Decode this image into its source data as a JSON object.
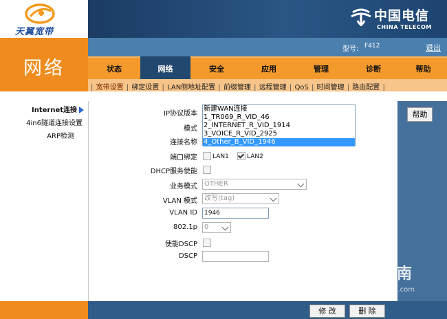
{
  "brand": {
    "left_logo_text": "天翼宽带",
    "right_logo_cn": "中国电信",
    "right_logo_en": "CHINA TELECOM"
  },
  "section_title": "网络",
  "model": {
    "label": "型号:",
    "value": "F412"
  },
  "logout_label": "退出",
  "tabs": [
    {
      "label": "状态"
    },
    {
      "label": "网络",
      "active": true
    },
    {
      "label": "安全"
    },
    {
      "label": "应用"
    },
    {
      "label": "管理"
    },
    {
      "label": "诊断"
    },
    {
      "label": "帮助"
    }
  ],
  "subnav": [
    "宽带设置",
    "绑定设置",
    "LAN侧地址配置",
    "前缀管理",
    "远程管理",
    "QoS",
    "时间管理",
    "路由配置"
  ],
  "leftnav": [
    {
      "label": "Internet连接",
      "active": true
    },
    {
      "label": "4in6隧道连接设置"
    },
    {
      "label": "ARP检测"
    }
  ],
  "help_button": "帮助",
  "form": {
    "ip_protocol_label": "IP协议版本",
    "mode_label": "模式",
    "conn_name_label": "连接名称",
    "connections": [
      "新建WAN连接",
      "1_TR069_R_VID_46",
      "2_INTERNET_R_VID_1914",
      "3_VOICE_R_VID_2925",
      "4_Other_B_VID_1946"
    ],
    "selected_connection": "4_Other_B_VID_1946",
    "port_bind_label": "端口绑定",
    "lan1_label": "LAN1",
    "lan2_label": "LAN2",
    "lan1_checked": false,
    "lan2_checked": true,
    "dhcp_label": "DHCP服务使能",
    "dhcp_checked": false,
    "service_mode_label": "业务模式",
    "service_mode_value": "OTHER",
    "vlan_mode_label": "VLAN 模式",
    "vlan_mode_value": "改写(tag)",
    "vlan_id_label": "VLAN ID",
    "vlan_id_value": "1946",
    "p8021_label": "802.1p",
    "p8021_value": "0",
    "dscp_enable_label": "使能DSCP",
    "dscp_enable_checked": false,
    "dscp_label": "DSCP",
    "dscp_value": ""
  },
  "buttons": {
    "modify": "修 改",
    "delete": "删 除"
  },
  "watermark": {
    "text": "搜狗指南",
    "url": "zhinan.sogou.com"
  },
  "colors": {
    "orange": "#ef8c1d",
    "tab_orange": "#f49a2c",
    "navy": "#21496f",
    "blue": "#4a7fae",
    "selection": "#3399ff"
  }
}
